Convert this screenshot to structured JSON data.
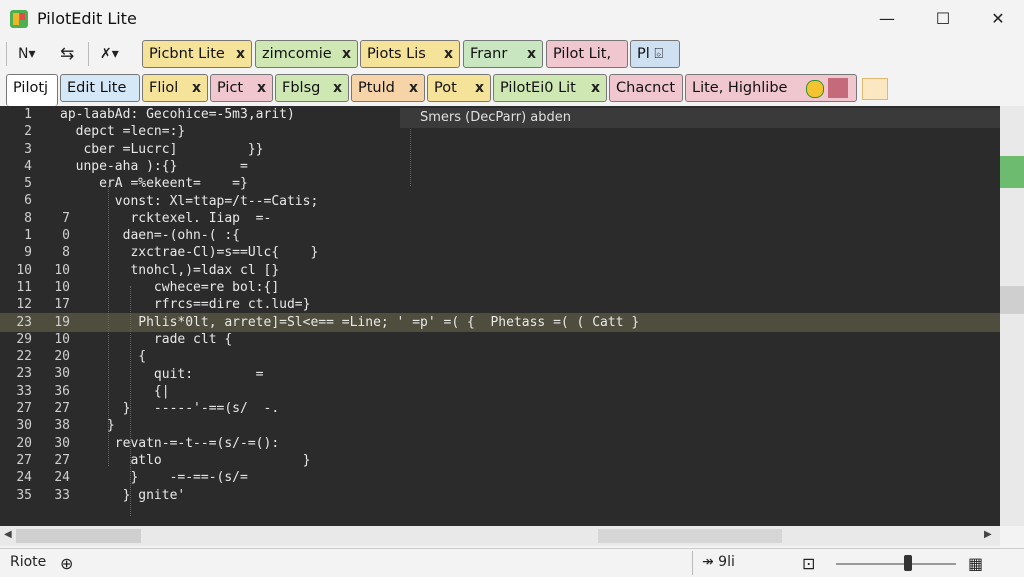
{
  "window": {
    "title": "PilotEdit Lite",
    "minimize": "—",
    "maximize": "☐",
    "close": "✕"
  },
  "toolbar": {
    "items": [
      "N▾",
      "⇆",
      "✗▾"
    ]
  },
  "tabs_row1": [
    {
      "label": "Picbnt Lite",
      "close": "x",
      "color": "#f6e39a"
    },
    {
      "label": "zimcomie",
      "close": "x",
      "color": "#cfe7b2"
    },
    {
      "label": "Piots Lis",
      "close": "x",
      "color": "#f6e39a"
    },
    {
      "label": "Franr",
      "close": "x",
      "color": "#c8e6c0"
    },
    {
      "label": "Pilot Lit,",
      "close": "",
      "color": "#f0c7cf"
    },
    {
      "label": "Pl  ⌺",
      "close": "",
      "color": "#cfe0f2"
    }
  ],
  "tabs_row2": [
    {
      "label": "Pilotj",
      "close": "",
      "color": "#ffffff"
    },
    {
      "label": "Edit Lite",
      "close": "",
      "color": "#d5e8f7"
    },
    {
      "label": "Fliol",
      "close": "x",
      "color": "#f6e39a"
    },
    {
      "label": "Pict",
      "close": "x",
      "color": "#f0c7cf"
    },
    {
      "label": "Fblsg",
      "close": "x",
      "color": "#cfe7b2"
    },
    {
      "label": "Ptuld",
      "close": "x",
      "color": "#f7d4a8"
    },
    {
      "label": "Pot",
      "close": "x",
      "color": "#f6e39a"
    },
    {
      "label": "PilotEi0 Lit",
      "close": "x",
      "color": "#cfe7b2"
    },
    {
      "label": "Chacnct",
      "close": "",
      "color": "#f0c7cf"
    },
    {
      "label": "Lite, Highlibe",
      "close": "",
      "color": "#f0c7cf"
    }
  ],
  "editor": {
    "hint": "Smers (DecParr) abden",
    "gutter1": [
      "1",
      "2",
      "3",
      "4",
      "5",
      "6",
      "8",
      "1",
      "9",
      "10",
      "11",
      "12",
      "23",
      "29",
      "22",
      "23",
      "33",
      "27",
      "30",
      "20",
      "27",
      "24",
      "35"
    ],
    "gutter2": [
      "",
      "",
      "",
      "",
      "",
      "",
      "7",
      "0",
      "8",
      "10",
      "10",
      "17",
      "19",
      "10",
      "20",
      "30",
      "36",
      "27",
      "38",
      "30",
      "27",
      "24",
      "33"
    ],
    "lines": [
      "ap-laabAd: Gecohice=-5m3,arit)",
      "  depct =lecn=:}",
      "   cber =Lucrc]         }}",
      "  unpe-aha ):{}        =",
      "     erA =%ekeent=    =}",
      "       vonst: Xl=ttap=/t--=Catis;",
      "         rcktexel. Iiap  =-",
      "        daen=-(ohn-( :{",
      "         zxctrae-Cl)=s==Ulc{    }",
      "         tnohcl,)=ldax cl [}",
      "            cwhece=re bol:{]",
      "            rfrcs==dire ct.lud=}",
      "          Phlis*0lt, arrete]=Sl<e== =Line; ' =p' =( {  Phetass =( ( Catt }",
      "            rade clt {",
      "          {",
      "            quit:        =",
      "            {|",
      "        }   -----'-==(s/  -.",
      "      }",
      "       revatn-=-t--=(s/-=(): ",
      "         atlo                  }",
      "         }    -=-==-(s/=",
      "        } gnite'"
    ]
  },
  "statusbar": {
    "left": "Riote",
    "goto": "↠ 9li",
    "zoom_icon": "⊡"
  }
}
